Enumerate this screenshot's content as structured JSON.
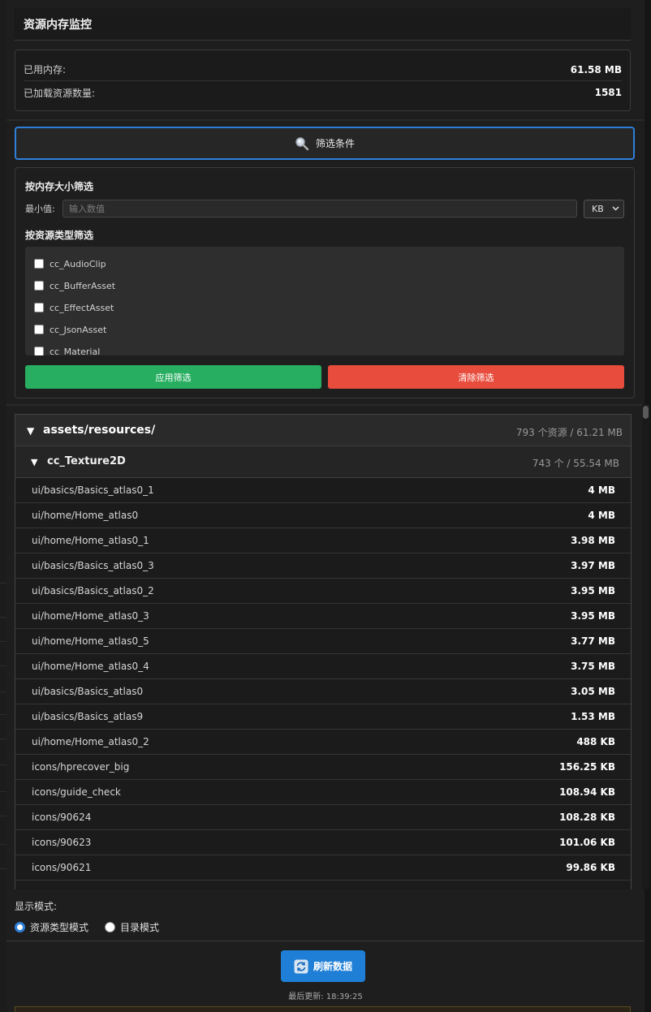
{
  "header": {
    "title": "资源内存监控"
  },
  "stats": [
    {
      "label": "已用内存:",
      "value": "61.58 MB"
    },
    {
      "label": "已加载资源数量:",
      "value": "1581"
    }
  ],
  "filter": {
    "toggle_label": "筛选条件",
    "toggle_icon": "magnifier-icon",
    "size_heading": "按内存大小筛选",
    "min_label": "最小值:",
    "min_placeholder": "输入数值",
    "min_value": "",
    "unit": "KB",
    "type_heading": "按资源类型筛选",
    "types": [
      {
        "label": "cc_AudioClip",
        "checked": false
      },
      {
        "label": "cc_BufferAsset",
        "checked": false
      },
      {
        "label": "cc_EffectAsset",
        "checked": false
      },
      {
        "label": "cc_JsonAsset",
        "checked": false
      },
      {
        "label": "cc_Material",
        "checked": false
      }
    ],
    "apply_label": "应用筛选",
    "clear_label": "清除筛选",
    "apply_color": "#27ae60",
    "clear_color": "#e74c3c"
  },
  "tree": {
    "group": {
      "name": "assets/resources/",
      "meta": "793 个资源 / 61.21 MB",
      "expanded": true
    },
    "subgroup": {
      "name": "cc_Texture2D",
      "meta": "743 个 / 55.54 MB",
      "expanded": true
    },
    "items": [
      {
        "name": "ui/basics/Basics_atlas0_1",
        "size": "4 MB"
      },
      {
        "name": "ui/home/Home_atlas0",
        "size": "4 MB"
      },
      {
        "name": "ui/home/Home_atlas0_1",
        "size": "3.98 MB"
      },
      {
        "name": "ui/basics/Basics_atlas0_3",
        "size": "3.97 MB"
      },
      {
        "name": "ui/basics/Basics_atlas0_2",
        "size": "3.95 MB"
      },
      {
        "name": "ui/home/Home_atlas0_3",
        "size": "3.95 MB"
      },
      {
        "name": "ui/home/Home_atlas0_5",
        "size": "3.77 MB"
      },
      {
        "name": "ui/home/Home_atlas0_4",
        "size": "3.75 MB"
      },
      {
        "name": "ui/basics/Basics_atlas0",
        "size": "3.05 MB"
      },
      {
        "name": "ui/basics/Basics_atlas9",
        "size": "1.53 MB"
      },
      {
        "name": "ui/home/Home_atlas0_2",
        "size": "488 KB"
      },
      {
        "name": "icons/hprecover_big",
        "size": "156.25 KB"
      },
      {
        "name": "icons/guide_check",
        "size": "108.94 KB"
      },
      {
        "name": "icons/90624",
        "size": "108.28 KB"
      },
      {
        "name": "icons/90623",
        "size": "101.06 KB"
      },
      {
        "name": "icons/90621",
        "size": "99.86 KB"
      }
    ]
  },
  "display_mode": {
    "title": "显示模式:",
    "options": [
      {
        "label": "资源类型模式",
        "selected": true
      },
      {
        "label": "目录模式",
        "selected": false
      }
    ]
  },
  "refresh": {
    "label": "刷新数据",
    "icon": "refresh-icon",
    "color": "#1f7fd6"
  },
  "last_update": {
    "label": "最后更新:",
    "time": "18:39:25"
  }
}
